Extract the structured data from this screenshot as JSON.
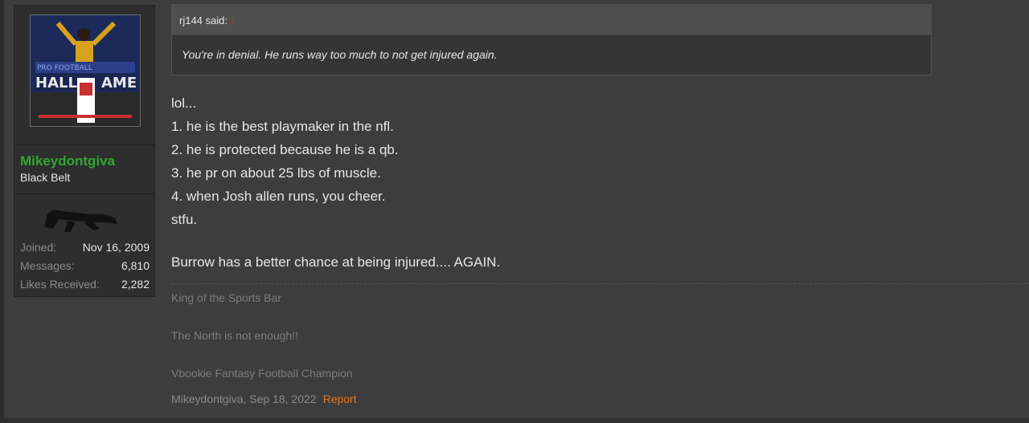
{
  "user": {
    "username": "Mikeydontgiva",
    "title": "Black Belt",
    "stats": [
      {
        "label": "Joined:",
        "value": "Nov 16, 2009"
      },
      {
        "label": "Messages:",
        "value": "6,810"
      },
      {
        "label": "Likes Received:",
        "value": "2,282"
      }
    ]
  },
  "quote": {
    "author": "rj144 said:",
    "arrow": "↑",
    "text": "You're in denial. He runs way too much to not get injured again."
  },
  "message": {
    "lines": [
      "lol...",
      "1. he is the best playmaker in the nfl.",
      "2. he is protected because he is a qb.",
      "3. he pr on about 25 lbs of muscle.",
      "4. when Josh allen runs, you cheer.",
      "stfu."
    ],
    "last_line": "Burrow has a better chance at being injured.... AGAIN."
  },
  "signature": [
    "King of the Sports Bar",
    "The North is not enough!!",
    "Vbookie Fantasy Football Champion"
  ],
  "meta": {
    "author_date": "Mikeydontgiva, Sep 18, 2022",
    "report": "Report"
  },
  "colors": {
    "username": "#2fa82f",
    "report": "#e8751a",
    "background": "#3d3d3d"
  }
}
